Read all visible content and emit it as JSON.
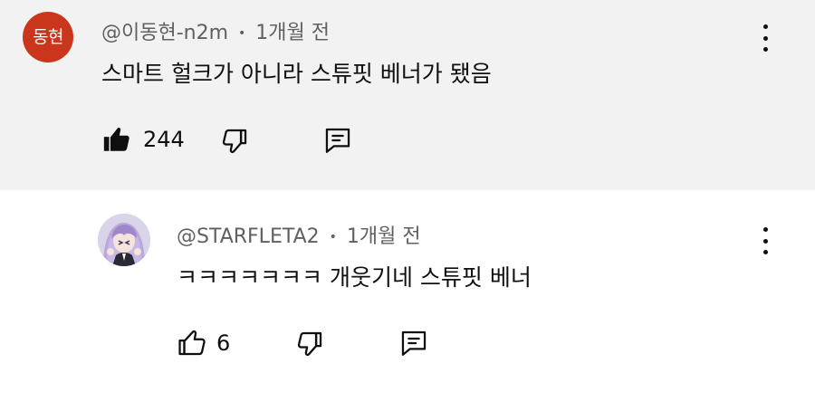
{
  "comments": [
    {
      "avatar_text": "동현",
      "author": "@이동현-n2m",
      "separator": "•",
      "time": "1개월 전",
      "text": "스마트 헐크가 아니라 스튜핏 베너가 됐음",
      "likes": "244",
      "liked": true,
      "highlighted": true
    },
    {
      "author": "@STARFLETA2",
      "separator": "•",
      "time": "1개월 전",
      "text": "ㅋㅋㅋㅋㅋㅋㅋ 개웃기네 스튜핏 베너",
      "likes": "6",
      "liked": false,
      "highlighted": false
    }
  ],
  "colors": {
    "highlight_bg": "#f2f2f2",
    "avatar_red": "#c9361c",
    "meta_text": "#606060"
  }
}
